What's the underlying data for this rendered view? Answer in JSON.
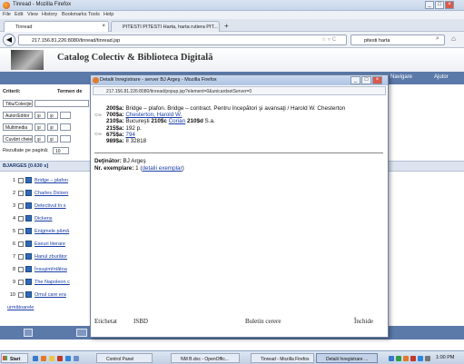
{
  "browser": {
    "title": "Tinread - Mozilla Firefox",
    "menu": [
      "File",
      "Edit",
      "View",
      "History",
      "Bookmarks",
      "Tools",
      "Help"
    ],
    "tabs": [
      {
        "label": "Tinread",
        "active": true
      },
      {
        "label": "PITESTI PITESTI Harta, harta rutiera PIT...",
        "active": false
      }
    ],
    "url": "217.156.81.226:8080/tinread/tinread.jsp",
    "search_value": "pitesti harta"
  },
  "page": {
    "header_title": "Catalog Colectiv & Biblioteca Digitală",
    "nav_items": [
      "Navigare",
      "Ajutor"
    ],
    "criteria_label": "Criterii:",
    "terms_label": "Termen de",
    "filters": [
      "Titlu/Colecţie",
      "Autor/Editor",
      "Multimedia",
      "Cuvânt cheie"
    ],
    "and_label": "şi",
    "results_per_page_label": "Rezultate pe pagină:",
    "results_per_page_value": "10",
    "results_header": "BJARGES [0.630 s]",
    "results": [
      {
        "num": "1",
        "title": "Bridge – plafon"
      },
      {
        "num": "2",
        "title": "Charles Dicken"
      },
      {
        "num": "3",
        "title": "Detectivul în s"
      },
      {
        "num": "4",
        "title": "Dickens"
      },
      {
        "num": "5",
        "title": "Enigmele pămâ"
      },
      {
        "num": "6",
        "title": "Eseuri literare"
      },
      {
        "num": "7",
        "title": "Hanul zburător"
      },
      {
        "num": "8",
        "title": "Însuşimîntătoa"
      },
      {
        "num": "9",
        "title": "The Napoleon c"
      },
      {
        "num": "10",
        "title": "Omul care era"
      }
    ],
    "next_link": "următoarele"
  },
  "popup": {
    "title": "Detalii înregistrare - server BJ Argeş - Mozilla Firefox",
    "url": "217.156.81.226:8080/tinread/popup.jsp?element=0&unicardsetServer=0",
    "record": {
      "l1_tag": "200$a:",
      "l1_text": "Bridge – plafon. Bridge – contract. Pentru începători şi avansaţi / Harold W. Chesterton",
      "l2_tag": "700$a:",
      "l2_link": "Chesterton, Harold W.",
      "l3_tag": "210$a:",
      "l3_text_a": "Bucureşti",
      "l3_tag_c": "210$c",
      "l3_link": "Corian",
      "l3_tag_d": "210$d",
      "l3_text_d": "S.a.",
      "l4_tag": "215$a:",
      "l4_text": "192 p.",
      "l5_tag": "675$a:",
      "l5_link": "794",
      "l6_tag": "989$a:",
      "l6_text": "II 32818"
    },
    "holder_label": "Deţinător:",
    "holder_value": "BJ Argeş",
    "copies_label": "Nr. exemplare:",
    "copies_value": "1",
    "copies_link": "detalii exemplar",
    "footer": [
      "Etichetat",
      "ISBD",
      "Buletin cerere",
      "Închide"
    ]
  },
  "taskbar": {
    "start": "Start",
    "items": [
      "Control Panel",
      "NM B.doc - OpenOffic...",
      "Tinread - Mozilla Firefox",
      "Detalii înregistrare ..."
    ],
    "clock": "1:00 PM"
  }
}
